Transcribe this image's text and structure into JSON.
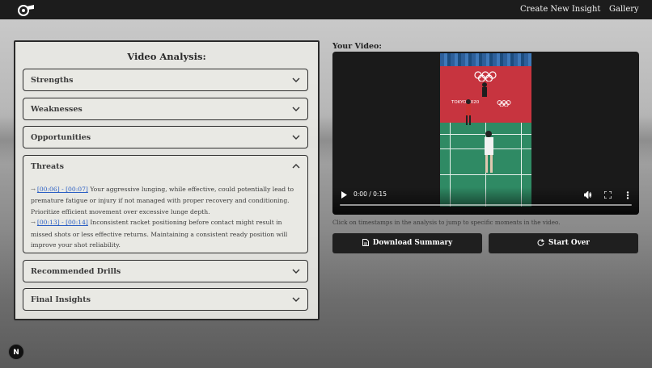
{
  "nav": {
    "create_label": "Create New Insight",
    "gallery_label": "Gallery"
  },
  "analysis": {
    "title": "Video Analysis:",
    "sections": [
      {
        "label": "Strengths",
        "expanded": false
      },
      {
        "label": "Weaknesses",
        "expanded": false
      },
      {
        "label": "Opportunities",
        "expanded": false
      },
      {
        "label": "Threats",
        "expanded": true
      },
      {
        "label": "Recommended Drills",
        "expanded": false
      },
      {
        "label": "Final Insights",
        "expanded": false
      }
    ],
    "threats_items": [
      {
        "timestamp": "[00:06] - [00:07]",
        "text": "Your aggressive lunging, while effective, could potentially lead to premature fatigue or injury if not managed with proper recovery and conditioning. Prioritize efficient movement over excessive lunge depth."
      },
      {
        "timestamp": "[00:13] - [00:14]",
        "text": "Inconsistent racket positioning before contact might result in missed shots or less effective returns. Maintaining a consistent ready position will improve your shot reliability."
      }
    ]
  },
  "video": {
    "label": "Your Video:",
    "time": "0:00 / 0:15",
    "frame_text": "TOKYO 2020",
    "progress": 0,
    "hint": "Click on timestamps in the analysis to jump to specific moments in the video."
  },
  "buttons": {
    "download_label": "Download Summary",
    "start_over_label": "Start Over"
  },
  "badge": {
    "letter": "N"
  }
}
